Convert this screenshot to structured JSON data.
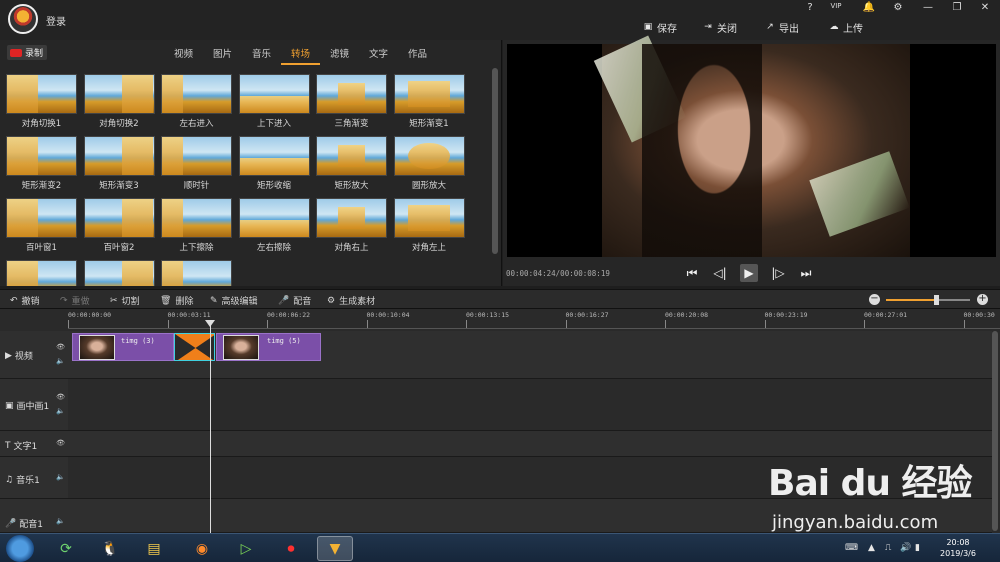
{
  "title_bar": {
    "login": "登录",
    "controls": [
      "?",
      "VIP",
      "🔔",
      "⚙",
      "—",
      "❐",
      "✕"
    ],
    "actions": [
      {
        "icon": "save-icon",
        "label": "保存"
      },
      {
        "icon": "close-project-icon",
        "label": "关闭"
      },
      {
        "icon": "export-icon",
        "label": "导出"
      },
      {
        "icon": "upload-icon",
        "label": "上传"
      }
    ]
  },
  "asset_panel": {
    "record_label": "录制",
    "tabs": [
      "视频",
      "图片",
      "音乐",
      "转场",
      "滤镜",
      "文字",
      "作品"
    ],
    "active_tab": "转场",
    "transitions": [
      "对角切换1",
      "对角切换2",
      "左右进入",
      "上下进入",
      "三角渐变",
      "矩形渐变1",
      "矩形渐变2",
      "矩形渐变3",
      "顺时针",
      "矩形收缩",
      "矩形放大",
      "圆形放大",
      "百叶窗1",
      "百叶窗2",
      "上下擦除",
      "左右擦除",
      "对角右上",
      "对角左上",
      "",
      "",
      ""
    ]
  },
  "preview": {
    "timecode": "00:00:04:24/00:00:08:19",
    "controls": [
      "skip-start",
      "step-back",
      "play",
      "step-forward",
      "skip-end"
    ]
  },
  "edit_toolbar": {
    "items": [
      {
        "icon": "undo-icon",
        "label": "撤销",
        "enabled": true
      },
      {
        "icon": "redo-icon",
        "label": "重做",
        "enabled": false
      },
      {
        "icon": "cut-icon",
        "label": "切割",
        "enabled": true
      },
      {
        "icon": "delete-icon",
        "label": "删除",
        "enabled": true
      },
      {
        "icon": "advanced-edit-icon",
        "label": "高级编辑",
        "enabled": true
      },
      {
        "icon": "voiceover-icon",
        "label": "配音",
        "enabled": true
      },
      {
        "icon": "generate-material-icon",
        "label": "生成素材",
        "enabled": true
      }
    ],
    "zoom_level": 0.6
  },
  "timeline": {
    "ruler": [
      "00:00:00:00",
      "00:00:03:11",
      "00:00:06:22",
      "00:00:10:04",
      "00:00:13:15",
      "00:00:16:27",
      "00:00:20:08",
      "00:00:23:19",
      "00:00:27:01",
      "00:00:30"
    ],
    "tracks": [
      {
        "icon": "▶",
        "label": "视频"
      },
      {
        "icon": "▣",
        "label": "画中画1"
      },
      {
        "icon": "T",
        "label": "文字1"
      },
      {
        "icon": "♫",
        "label": "音乐1"
      },
      {
        "icon": "🎤",
        "label": "配音1"
      }
    ],
    "clips": [
      {
        "name": "timg (3)"
      },
      {
        "name": "timg (5)"
      }
    ]
  },
  "taskbar": {
    "time": "20:08",
    "date": "2019/3/6"
  },
  "watermark": {
    "logo": "Bai du 经验",
    "sub": "jingyan.baidu.com"
  }
}
